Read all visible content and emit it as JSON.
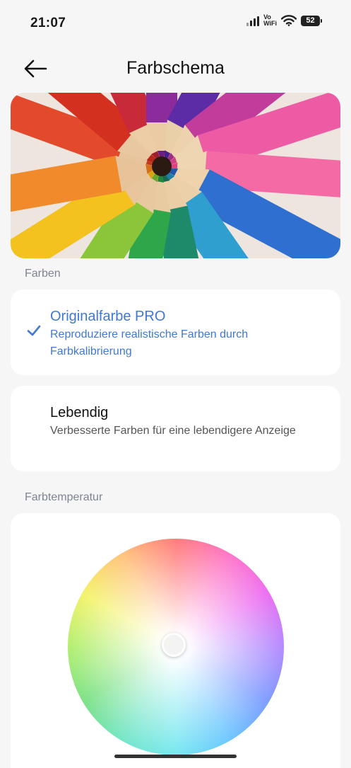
{
  "status_bar": {
    "time": "21:07",
    "vowifi_top": "Vo",
    "vowifi_bottom": "WiFi",
    "battery": "52"
  },
  "header": {
    "title": "Farbschema",
    "back_icon": "arrow-left-icon"
  },
  "sections": {
    "colors_label": "Farben",
    "temperature_label": "Farbtemperatur"
  },
  "options": [
    {
      "title": "Originalfarbe PRO",
      "description": "Reproduziere realistische Farben durch Farbkalibrierung",
      "selected": true
    },
    {
      "title": "Lebendig",
      "description": "Verbesserte Farben für eine lebendigere Anzeige",
      "selected": false
    }
  ],
  "colors": {
    "accent": "#3f78d6",
    "background": "#f6f6f6",
    "card": "#ffffff",
    "section_label": "#7f8492"
  }
}
